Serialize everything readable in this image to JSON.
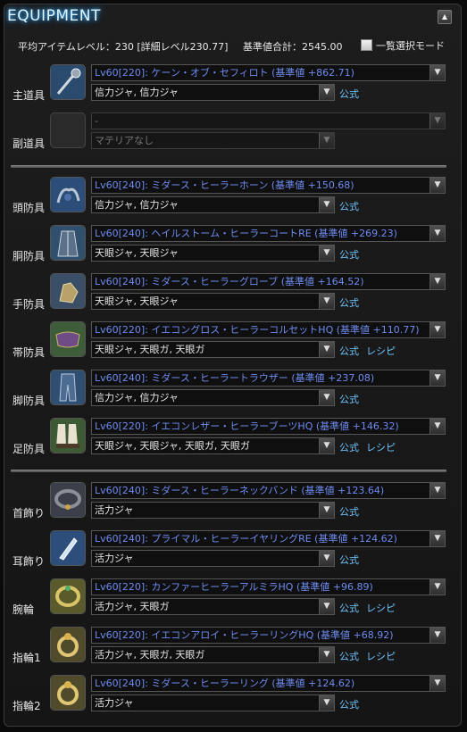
{
  "title": "EQUIPMENT",
  "summary": {
    "avg_item_level": "平均アイテムレベル：230 [詳細レベル230.77]",
    "total_base_value": "基準値合計：2545.00",
    "bulk_select_label": "一覧選択モード"
  },
  "links": {
    "formula": "公式",
    "recipe": "レシピ"
  },
  "slots": [
    {
      "label": "主道具",
      "item": "Lv60[220]: ケーン・オブ・セフィロト (基準値 +862.71)",
      "materia": "信力ジャ, 信力ジャ",
      "icon": "cane-icon",
      "show_formula": true,
      "show_recipe": false,
      "disabled": false
    },
    {
      "label": "副道具",
      "item": "-",
      "materia": "マテリアなし",
      "icon": "empty-slot-icon",
      "show_formula": false,
      "show_recipe": false,
      "disabled": true
    },
    {
      "label": "頭防具",
      "item": "Lv60[240]: ミダース・ヒーラーホーン (基準値 +150.68)",
      "materia": "信力ジャ, 信力ジャ",
      "icon": "horn-headgear-icon",
      "show_formula": true,
      "show_recipe": false,
      "disabled": false
    },
    {
      "label": "胴防具",
      "item": "Lv60[240]: ヘイルストーム・ヒーラーコートRE (基準値 +269.23)",
      "materia": "天眼ジャ, 天眼ジャ",
      "icon": "coat-icon",
      "show_formula": true,
      "show_recipe": false,
      "disabled": false
    },
    {
      "label": "手防具",
      "item": "Lv60[240]: ミダース・ヒーラーグローブ (基準値 +164.52)",
      "materia": "天眼ジャ, 天眼ジャ",
      "icon": "glove-icon",
      "show_formula": true,
      "show_recipe": false,
      "disabled": false
    },
    {
      "label": "帯防具",
      "item": "Lv60[220]: イエコングロス・ヒーラーコルセットHQ (基準値 +110.77)",
      "materia": "天眼ジャ, 天眼ガ, 天眼ガ",
      "icon": "corset-icon",
      "show_formula": true,
      "show_recipe": true,
      "disabled": false
    },
    {
      "label": "脚防具",
      "item": "Lv60[240]: ミダース・ヒーラートラウザー (基準値 +237.08)",
      "materia": "信力ジャ, 信力ジャ",
      "icon": "trousers-icon",
      "show_formula": true,
      "show_recipe": false,
      "disabled": false
    },
    {
      "label": "足防具",
      "item": "Lv60[220]: イエコンレザー・ヒーラーブーツHQ (基準値 +146.32)",
      "materia": "天眼ジャ, 天眼ジャ, 天眼ガ, 天眼ガ",
      "icon": "boots-icon",
      "show_formula": true,
      "show_recipe": true,
      "disabled": false
    },
    {
      "label": "首飾り",
      "item": "Lv60[240]: ミダース・ヒーラーネックバンド (基準値 +123.64)",
      "materia": "活力ジャ",
      "icon": "necklace-icon",
      "show_formula": true,
      "show_recipe": false,
      "disabled": false
    },
    {
      "label": "耳飾り",
      "item": "Lv60[240]: プライマル・ヒーラーイヤリングRE (基準値 +124.62)",
      "materia": "活力ジャ",
      "icon": "earring-icon",
      "show_formula": true,
      "show_recipe": false,
      "disabled": false
    },
    {
      "label": "腕輪",
      "item": "Lv60[220]: カンファーヒーラーアルミラHQ (基準値 +96.89)",
      "materia": "活力ジャ, 天眼ガ",
      "icon": "bracelet-icon",
      "show_formula": true,
      "show_recipe": true,
      "disabled": false
    },
    {
      "label": "指輪1",
      "item": "Lv60[220]: イエコンアロイ・ヒーラーリングHQ (基準値 +68.92)",
      "materia": "活力ジャ, 天眼ガ, 天眼ガ",
      "icon": "ring-icon",
      "show_formula": true,
      "show_recipe": true,
      "disabled": false
    },
    {
      "label": "指輪2",
      "item": "Lv60[240]: ミダース・ヒーラーリング (基準値 +124.62)",
      "materia": "活力ジャ",
      "icon": "ring-icon",
      "show_formula": true,
      "show_recipe": false,
      "disabled": false
    }
  ]
}
